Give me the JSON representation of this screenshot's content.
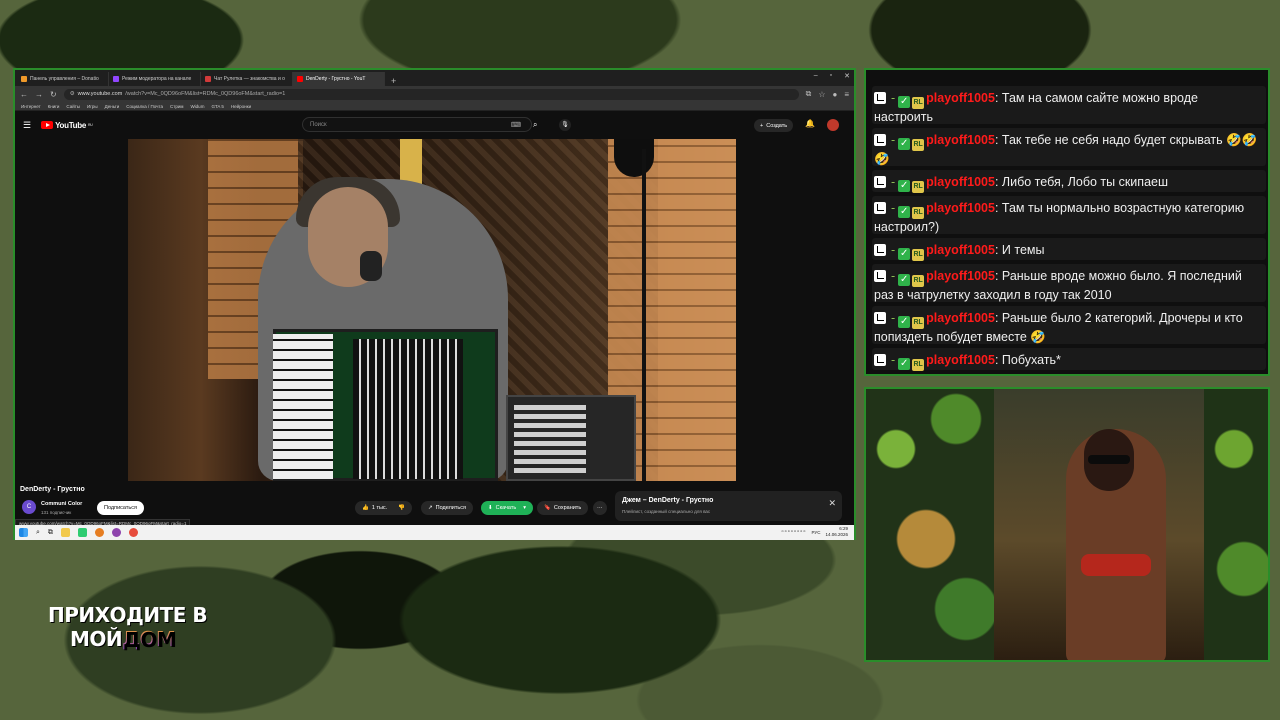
{
  "browser": {
    "tabs": [
      {
        "label": "Панель управления – Donatio",
        "color": "#f09a2a",
        "active": false
      },
      {
        "label": "Режим модератора на канале",
        "color": "#9146ff",
        "active": false
      },
      {
        "label": "Чат Рулетка — знакомства и о",
        "color": "#d13a3a",
        "active": false
      },
      {
        "label": "DenDerty - Грустно - YouT",
        "color": "#ff0000",
        "active": true
      }
    ],
    "address_host": "www.youtube.com",
    "address_path": "/watch?v=Mc_0QD96oFM&list=RDMc_0QD96oFM&start_radio=1",
    "bookmarks": [
      "Интернет",
      "Книги",
      "Сайты",
      "Игры",
      "Деньги",
      "Социалка / Почта",
      "Стрим",
      "Widum",
      "GTA 5",
      "Нейронки"
    ]
  },
  "youtube": {
    "logo": "YouTube",
    "logo_sup": "RU",
    "search_placeholder": "Поиск",
    "create_label": "Создать",
    "video_title": "DenDerty - Грустно",
    "channel_initial": "C",
    "channel_name": "Communi Color",
    "channel_subs": "131 подписчик",
    "subscribe_label": "Подписаться",
    "like_count": "1 тыс.",
    "share_label": "Поделиться",
    "download_label": "Скачать",
    "save_label": "Сохранить",
    "more_label": "···",
    "mix_title": "Джем – DenDerty - Грустно",
    "mix_subtitle": "Плейлист, созданный специально для вас",
    "status_url": "www.youtube.com/watch?v=Mc_0QD96oFM&list=RDMc_0QD96oFM&start_radio=1"
  },
  "taskbar": {
    "lang": "РУС",
    "time": "6:29",
    "date": "14.06.2026"
  },
  "chat": {
    "username": "playoff1005",
    "badge_dash": "-",
    "badge_rl": "RL",
    "messages": [
      {
        "text": "Там на самом сайте можно вроде настроить"
      },
      {
        "text": "Так тебе не себя надо будет скрывать 🤣🤣🤣"
      },
      {
        "text": "Либо тебя, Лобо ты скипаеш"
      },
      {
        "text": "Там ты нормально возрастную категорию настроил?)"
      },
      {
        "text": "И темы"
      },
      {
        "text": "Раньше вроде можно было. Я последний раз в чатрулетку заходил в году так 2010"
      },
      {
        "text": "Раньше было 2 категорий. Дрочеры и кто попиздеть побудет вместе 🤣"
      },
      {
        "text": "Побухать*"
      }
    ]
  },
  "overlay": {
    "line1": "ПРИХОДИТЕ В",
    "line2a": "МОЙ",
    "line2b": "ДОМ"
  },
  "colors": {
    "frame_green": "#2a8d2a",
    "username_red": "#ff1a1a",
    "youtube_red": "#ff0000",
    "download_green": "#1fb157"
  }
}
